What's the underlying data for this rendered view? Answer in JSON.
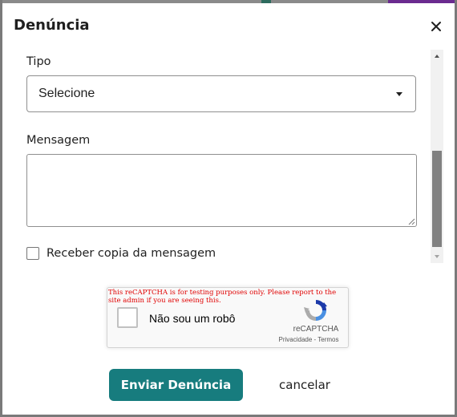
{
  "background": {
    "page_strip_color": "#8a8a8a",
    "accent_bit_color": "#6b2b8f"
  },
  "modal": {
    "title": "Denúncia",
    "close_icon": "close-icon"
  },
  "form": {
    "tipo_label": "Tipo",
    "tipo_selected": "Selecione",
    "mensagem_label": "Mensagem",
    "mensagem_value": "",
    "copy_checkbox_label": "Receber copia da mensagem",
    "copy_checkbox_checked": false
  },
  "recaptcha": {
    "warning": "This reCAPTCHA is for testing purposes only. Please report to the site admin if you are seeing this.",
    "checkbox_label": "Não sou um robô",
    "brand": "reCAPTCHA",
    "privacy_link": "Privacidade",
    "separator": "-",
    "terms_link": "Termos"
  },
  "actions": {
    "submit_label": "Enviar Denúncia",
    "cancel_label": "cancelar",
    "submit_color": "#177c7e"
  }
}
